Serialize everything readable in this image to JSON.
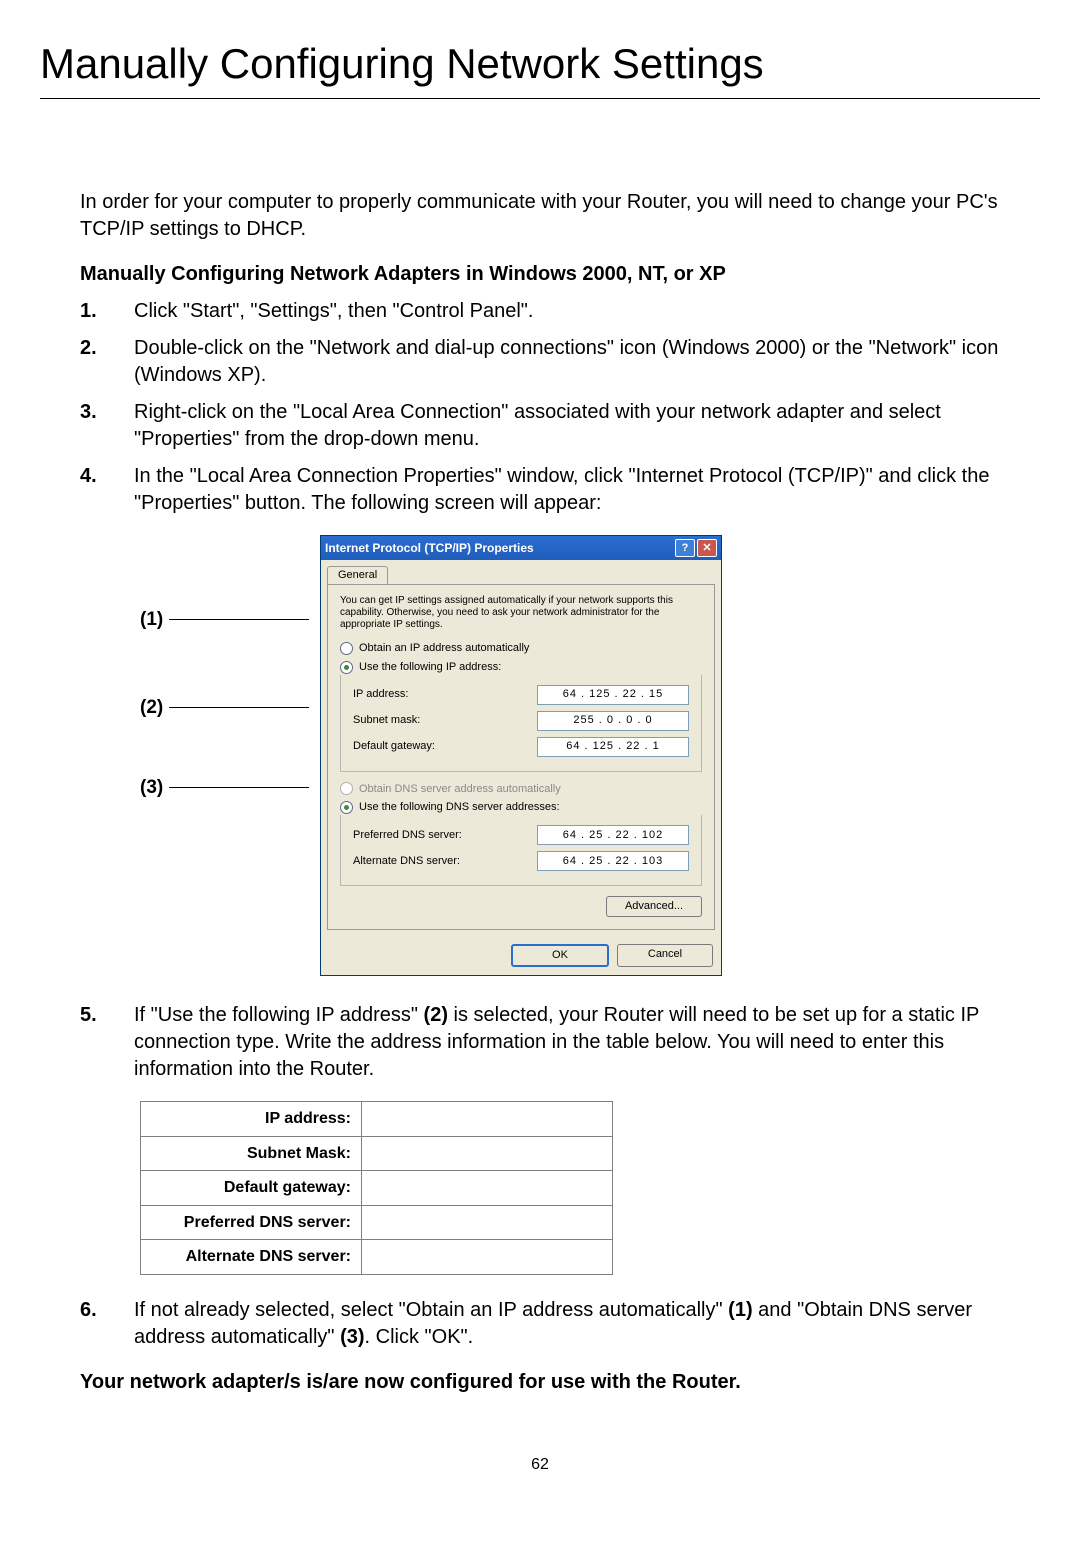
{
  "title": "Manually Configuring Network Settings",
  "intro": "In order for your computer to properly communicate with your Router, you will need to change your PC's TCP/IP settings to DHCP.",
  "subhead": "Manually Configuring Network Adapters in Windows 2000, NT, or XP",
  "steps": [
    {
      "num": "1.",
      "text": "Click \"Start\", \"Settings\", then \"Control Panel\"."
    },
    {
      "num": "2.",
      "text": "Double-click on the \"Network and dial-up connections\" icon (Windows 2000) or the \"Network\" icon (Windows XP)."
    },
    {
      "num": "3.",
      "text": "Right-click on the \"Local Area Connection\" associated with your network adapter and select \"Properties\" from the drop-down menu."
    },
    {
      "num": "4.",
      "text": "In the \"Local Area Connection Properties\" window, click \"Internet Protocol (TCP/IP)\" and click the \"Properties\" button. The following screen will appear:"
    }
  ],
  "callouts": {
    "c1": "(1)",
    "c2": "(2)",
    "c3": "(3)"
  },
  "dialog": {
    "title": "Internet Protocol (TCP/IP) Properties",
    "help": "?",
    "close": "✕",
    "tab": "General",
    "desc": "You can get IP settings assigned automatically if your network supports this capability. Otherwise, you need to ask your network administrator for the appropriate IP settings.",
    "radio_auto_ip": "Obtain an IP address automatically",
    "radio_use_ip": "Use the following IP address:",
    "ip_label": "IP address:",
    "ip_value": "64 . 125 . 22 . 15",
    "mask_label": "Subnet mask:",
    "mask_value": "255 . 0 . 0 . 0",
    "gw_label": "Default gateway:",
    "gw_value": "64 . 125 . 22 . 1",
    "radio_auto_dns": "Obtain DNS server address automatically",
    "radio_use_dns": "Use the following DNS server addresses:",
    "pdns_label": "Preferred DNS server:",
    "pdns_value": "64 . 25 . 22 . 102",
    "adns_label": "Alternate DNS server:",
    "adns_value": "64 . 25 . 22 . 103",
    "advanced": "Advanced...",
    "ok": "OK",
    "cancel": "Cancel"
  },
  "step5": {
    "num": "5.",
    "pre": "If \"Use the following IP address\" ",
    "ref": "(2)",
    "post": " is selected, your Router will need to be set up for a static IP connection type. Write the address information in the table below. You will need to enter this information into the Router."
  },
  "notes_table": {
    "rows": [
      "IP address:",
      "Subnet Mask:",
      "Default gateway:",
      "Preferred DNS server:",
      "Alternate DNS server:"
    ]
  },
  "step6": {
    "num": "6.",
    "pre": "If not already selected, select \"Obtain an IP address automatically\" ",
    "ref1": "(1)",
    "mid": " and \"Obtain DNS server address automatically\" ",
    "ref2": "(3)",
    "post": ". Click \"OK\"."
  },
  "conclusion": "Your network adapter/s is/are now configured for use with the Router.",
  "page_number": "62"
}
